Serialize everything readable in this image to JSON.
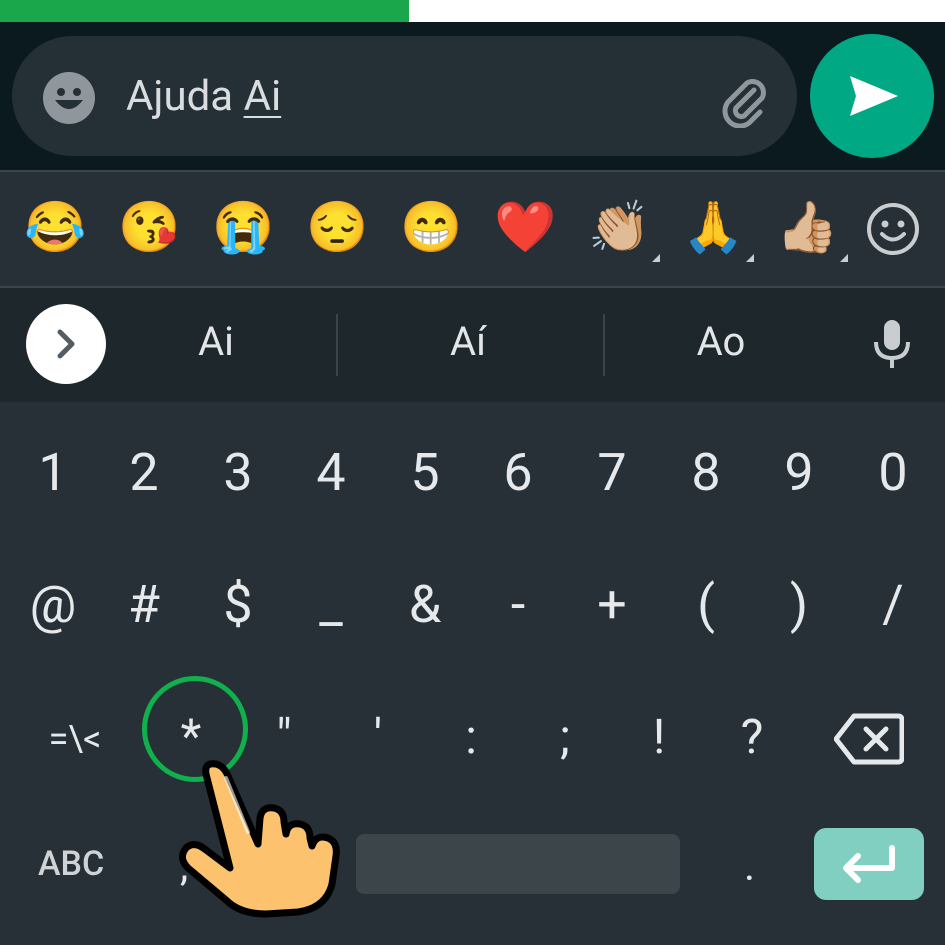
{
  "progress": {
    "fraction": 0.433,
    "color": "#1aa74b"
  },
  "composer": {
    "text_before": "Ajuda ",
    "current_word": "Ai"
  },
  "emoji_bar": {
    "items": [
      "😂",
      "😘",
      "😭",
      "😔",
      "😁",
      "❤️",
      "👏🏼",
      "🙏",
      "👍🏼"
    ]
  },
  "suggestions": {
    "items": [
      "Ai",
      "Aí",
      "Ao"
    ]
  },
  "keyboard": {
    "row1": [
      "1",
      "2",
      "3",
      "4",
      "5",
      "6",
      "7",
      "8",
      "9",
      "0"
    ],
    "row2": [
      "@",
      "#",
      "$",
      "_",
      "&",
      "-",
      "+",
      "(",
      ")",
      "/"
    ],
    "row3": [
      "=\\<",
      "*",
      "\"",
      "'",
      ":",
      ";",
      "!",
      "?"
    ],
    "mode_key": "ABC",
    "comma": ",",
    "period": "."
  },
  "highlighted_key": "*"
}
